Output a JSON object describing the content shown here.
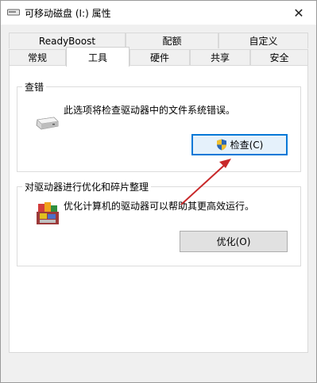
{
  "window": {
    "title": "可移动磁盘 (I:) 属性",
    "close_glyph": "✕"
  },
  "tabs": {
    "row1": [
      "ReadyBoost",
      "配额",
      "自定义"
    ],
    "row2": [
      "常规",
      "工具",
      "硬件",
      "共享",
      "安全"
    ],
    "active": "工具"
  },
  "error_check": {
    "title": "查错",
    "description": "此选项将检查驱动器中的文件系统错误。",
    "button_label": "检查(C)"
  },
  "optimize": {
    "title": "对驱动器进行优化和碎片整理",
    "description": "优化计算机的驱动器可以帮助其更高效运行。",
    "button_label": "优化(O)"
  },
  "colors": {
    "focus_border": "#0078d7",
    "annotation_arrow": "#c8282a"
  }
}
